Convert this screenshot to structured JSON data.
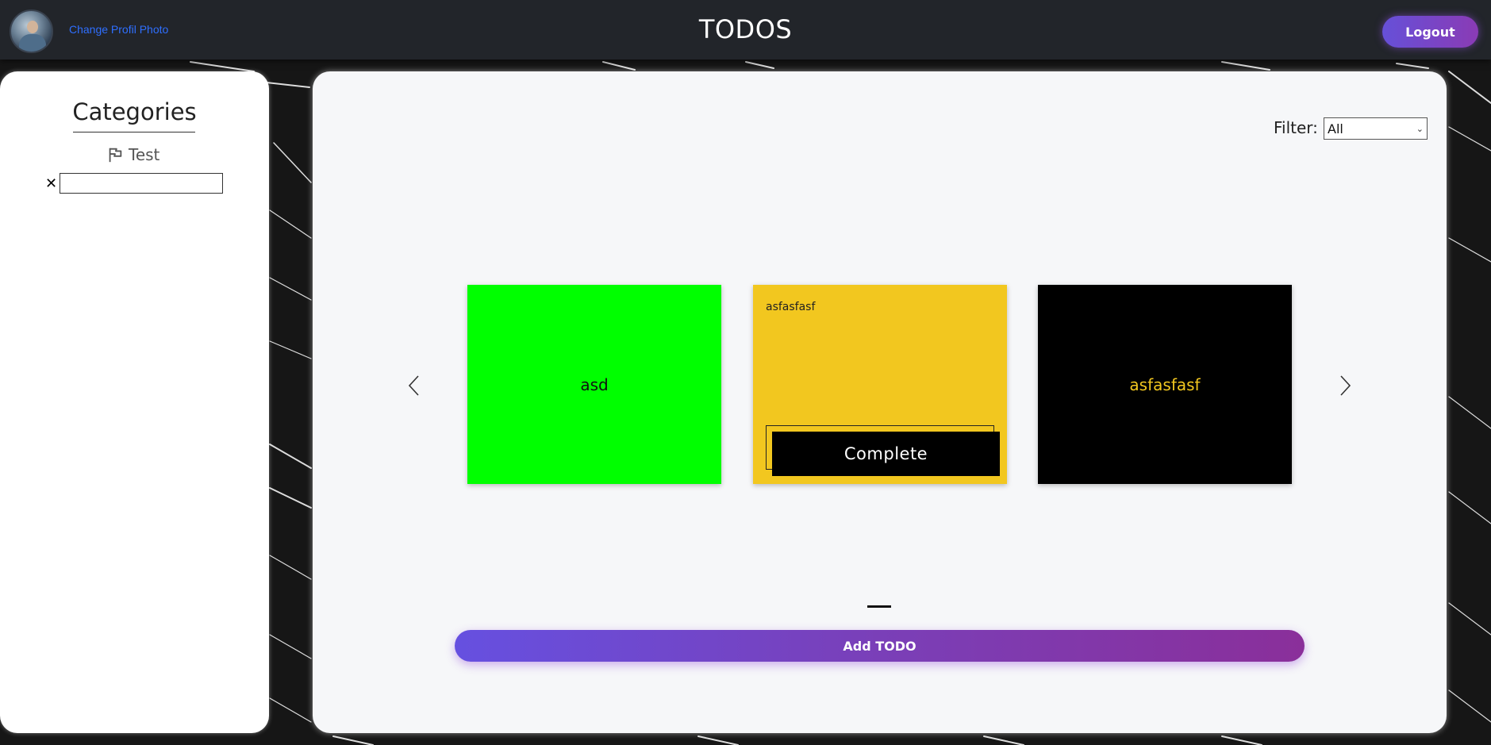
{
  "header": {
    "change_photo_label": "Change Profil Photo",
    "title": "TODOS",
    "logout_label": "Logout"
  },
  "sidebar": {
    "title": "Categories",
    "categories": [
      {
        "label": "Test",
        "icon": "flag-icon"
      }
    ],
    "new_category": {
      "remove_symbol": "✕",
      "value": "",
      "placeholder": ""
    }
  },
  "main": {
    "filter_label": "Filter:",
    "filter_selected": "All",
    "cards": [
      {
        "color": "#00ff00",
        "text": "asd",
        "text_color": "#111111"
      },
      {
        "color": "#f2c71f",
        "text": "asfasfasf",
        "action_label": "Complete"
      },
      {
        "color": "#000000",
        "text": "asfasfasf",
        "text_color": "#f2c71f"
      }
    ],
    "add_button_label": "Add TODO"
  },
  "colors": {
    "navbar": "#22252a",
    "accent_gradient_start": "#6650e0",
    "accent_gradient_end": "#8a2f9a",
    "link_blue": "#2f6fff",
    "panel_bg": "#f6f7f9"
  }
}
